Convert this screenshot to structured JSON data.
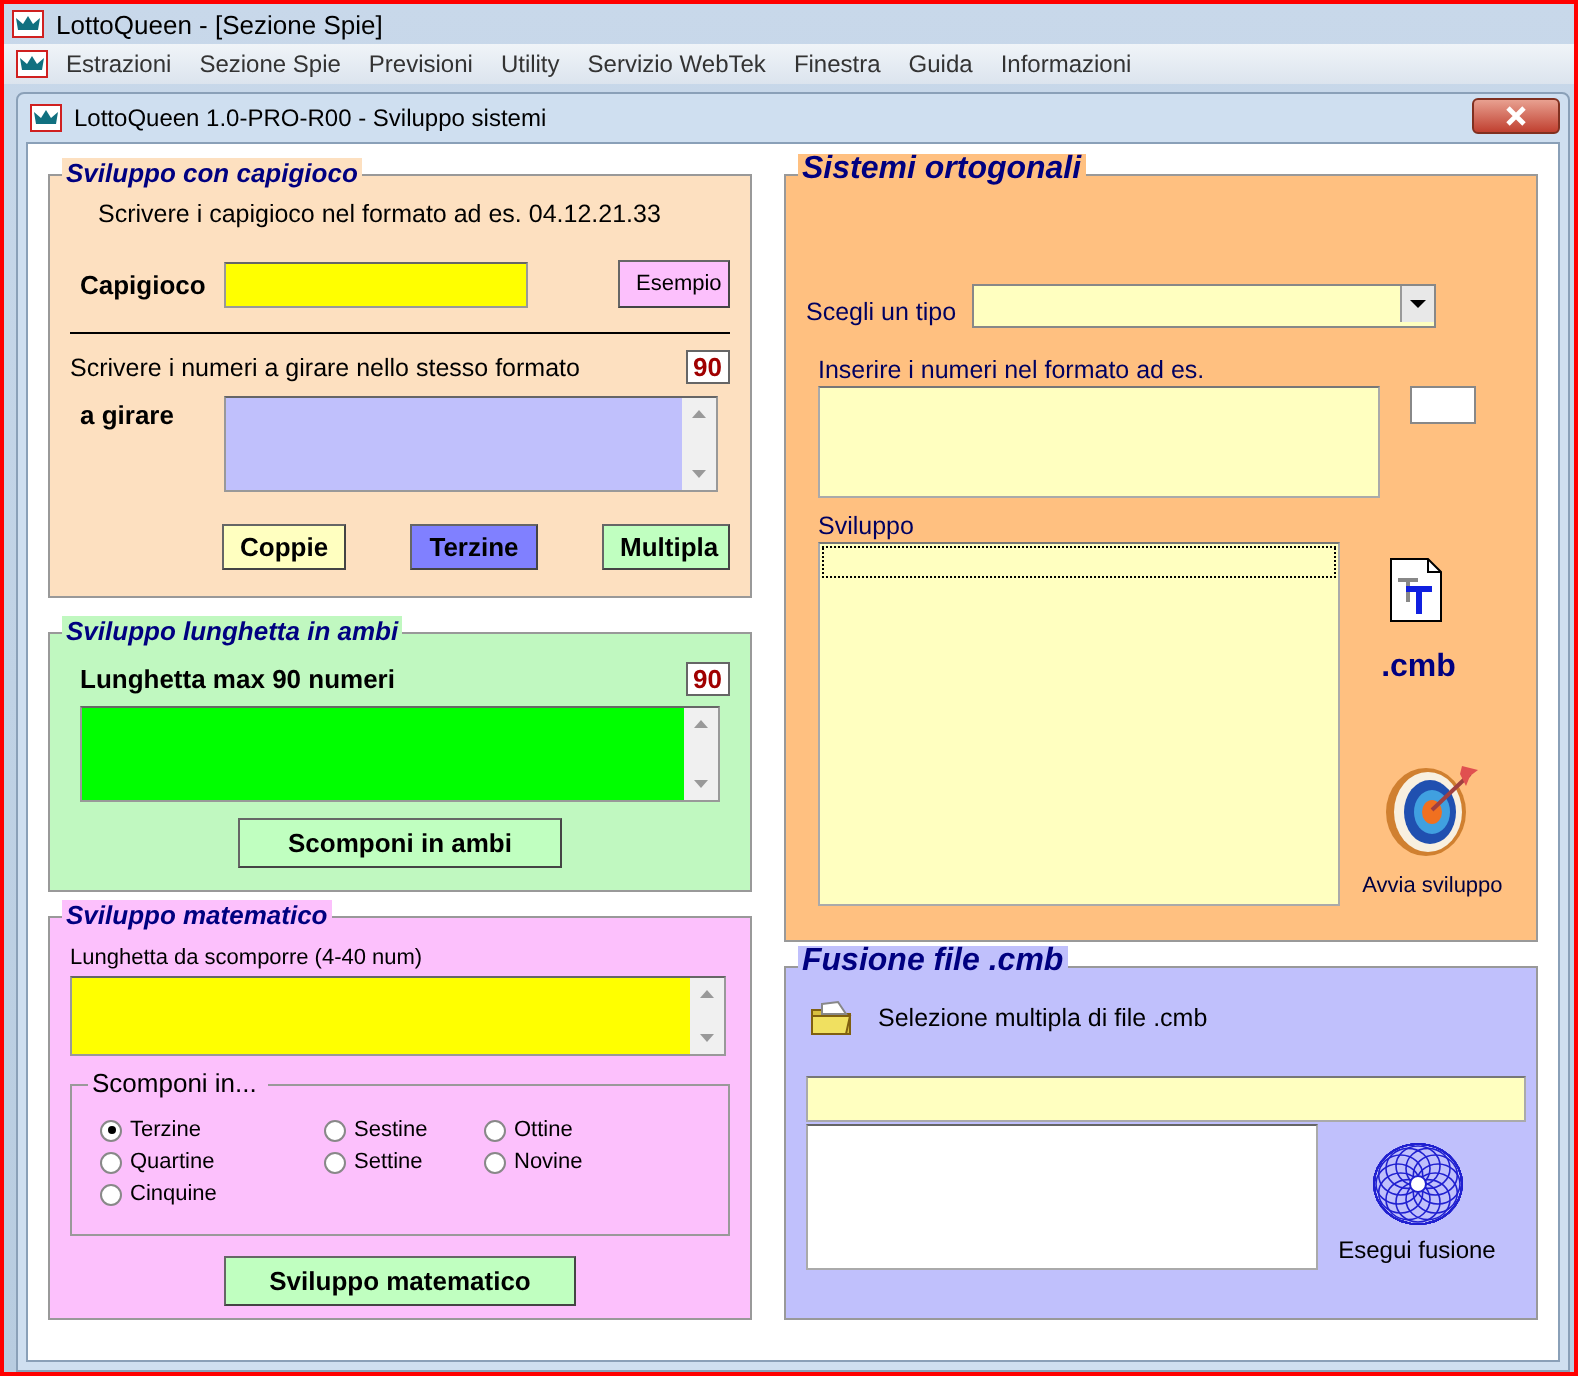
{
  "app_title": "LottoQueen - [Sezione Spie]",
  "menu": [
    "Estrazioni",
    "Sezione Spie",
    "Previsioni",
    "Utility",
    "Servizio WebTek",
    "Finestra",
    "Guida",
    "Informazioni"
  ],
  "window": {
    "title": "LottoQueen 1.0-PRO-R00 - Sviluppo sistemi"
  },
  "capigioco": {
    "title": "Sviluppo con capigioco",
    "instruction": "Scrivere i capigioco nel formato ad es. 04.12.21.33",
    "field_label": "Capigioco",
    "example_button": "Esempio",
    "spin_instruction": "Scrivere i numeri a girare nello stesso formato",
    "spin_count": "90",
    "spin_label": "a girare",
    "buttons": [
      {
        "label": "Coppie",
        "color": "#ffffc0"
      },
      {
        "label": "Terzine",
        "color": "#8080ff"
      },
      {
        "label": "Multipla",
        "color": "#c0ffc0"
      }
    ]
  },
  "ambi": {
    "title": "Sviluppo lunghetta in ambi",
    "label": "Lunghetta max 90 numeri",
    "count": "90",
    "button": "Scomponi in ambi"
  },
  "matematico": {
    "title": "Sviluppo matematico",
    "field_label": "Lunghetta da scomporre (4-40 num)",
    "group_title": "Scomponi in...",
    "option_columns": [
      [
        {
          "label": "Terzine",
          "selected": true
        },
        {
          "label": "Quartine",
          "selected": false
        },
        {
          "label": "Cinquine",
          "selected": false
        }
      ],
      [
        {
          "label": "Sestine",
          "selected": false
        },
        {
          "label": "Settine",
          "selected": false
        }
      ],
      [
        {
          "label": "Ottine",
          "selected": false
        },
        {
          "label": "Novine",
          "selected": false
        }
      ]
    ],
    "button": "Sviluppo matematico"
  },
  "ortogonali": {
    "title": "Sistemi ortogonali",
    "type_label": "Scegli un tipo",
    "numbers_label": "Inserire i numeri nel formato ad es.",
    "result_label": "Sviluppo",
    "extension": ".cmb",
    "start_label": "Avvia sviluppo"
  },
  "fusione": {
    "title": "Fusione file .cmb",
    "select_label": "Selezione multipla di file .cmb",
    "run_label": "Esegui fusione"
  }
}
